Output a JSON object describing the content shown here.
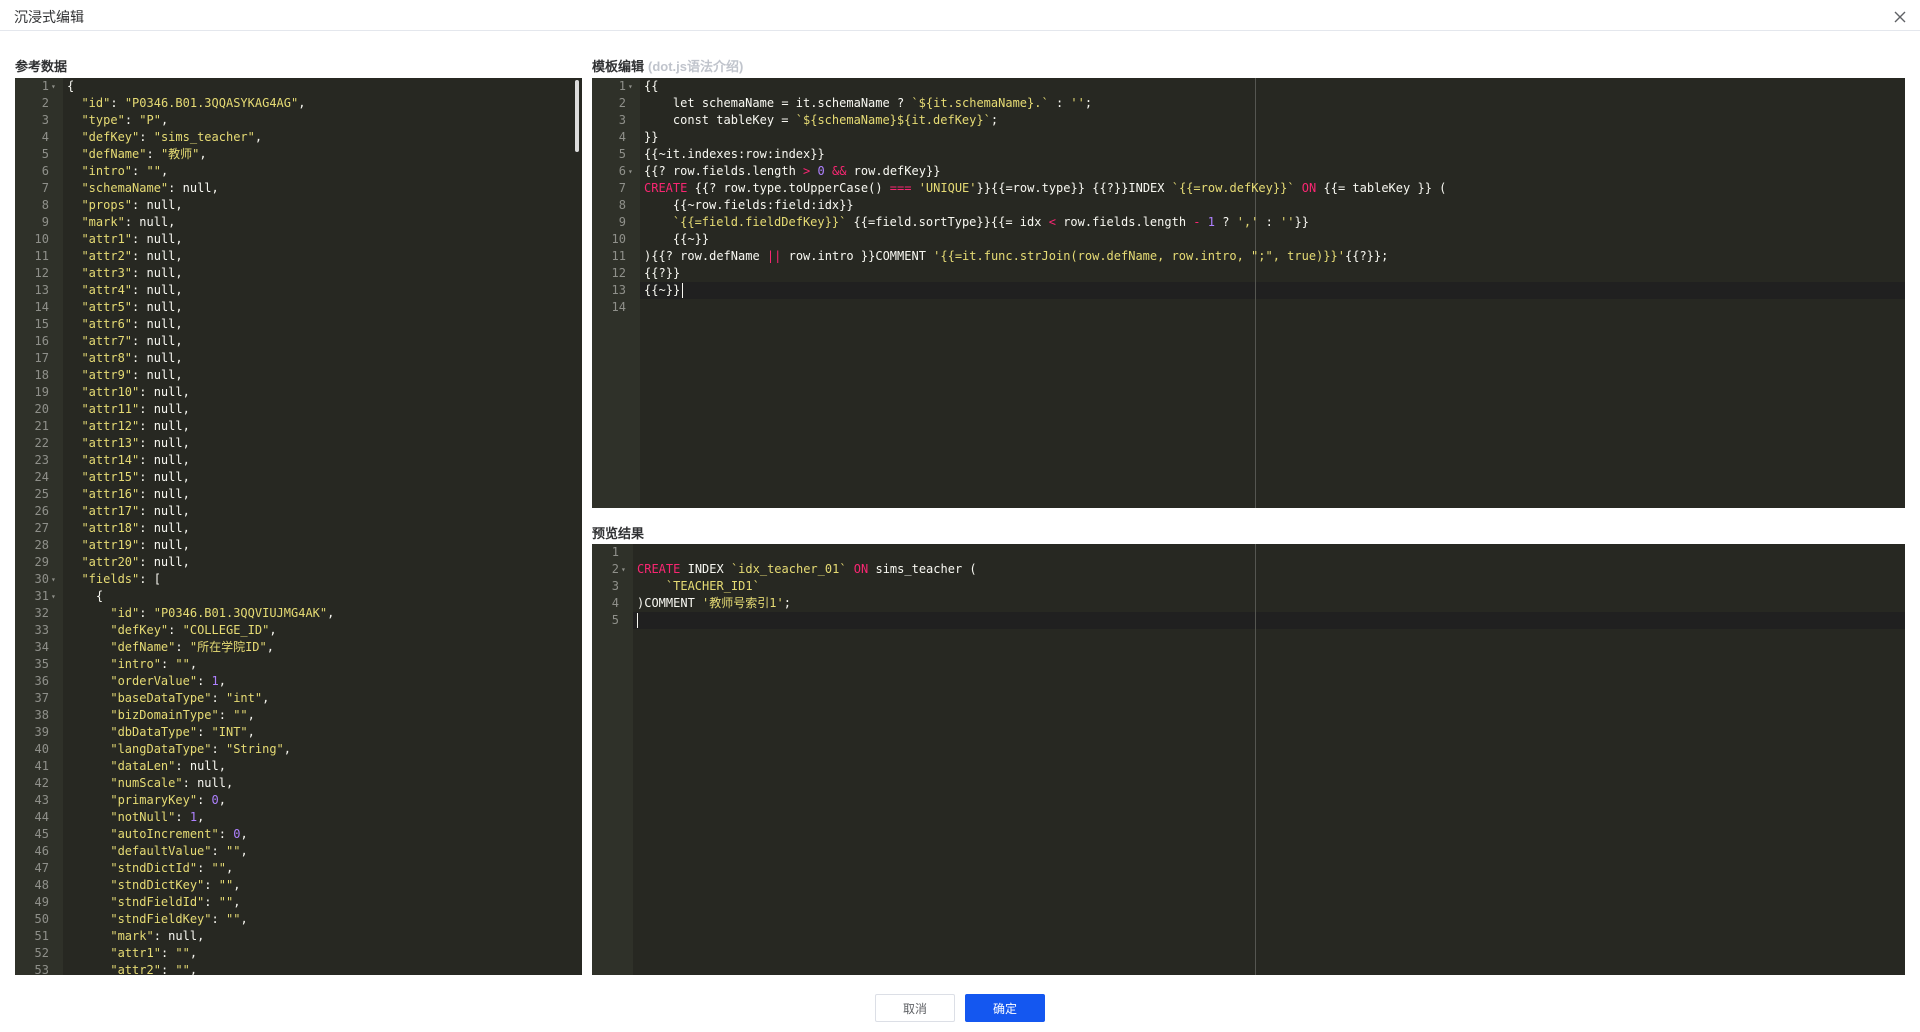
{
  "dialog": {
    "title": "沉浸式编辑"
  },
  "icons": {
    "close": "close-icon",
    "fold": "fold-arrow-icon"
  },
  "colors": {
    "editor_bg": "#272822",
    "primary_button": "#1457f0",
    "keyword": "#f92672",
    "string": "#e6db74",
    "number": "#ae81ff"
  },
  "reference": {
    "label": "参考数据",
    "lines": [
      "{",
      "  \"id\": \"P0346.B01.3QQASYKAG4AG\",",
      "  \"type\": \"P\",",
      "  \"defKey\": \"sims_teacher\",",
      "  \"defName\": \"教师\",",
      "  \"intro\": \"\",",
      "  \"schemaName\": null,",
      "  \"props\": null,",
      "  \"mark\": null,",
      "  \"attr1\": null,",
      "  \"attr2\": null,",
      "  \"attr3\": null,",
      "  \"attr4\": null,",
      "  \"attr5\": null,",
      "  \"attr6\": null,",
      "  \"attr7\": null,",
      "  \"attr8\": null,",
      "  \"attr9\": null,",
      "  \"attr10\": null,",
      "  \"attr11\": null,",
      "  \"attr12\": null,",
      "  \"attr13\": null,",
      "  \"attr14\": null,",
      "  \"attr15\": null,",
      "  \"attr16\": null,",
      "  \"attr17\": null,",
      "  \"attr18\": null,",
      "  \"attr19\": null,",
      "  \"attr20\": null,",
      "  \"fields\": [",
      "    {",
      "      \"id\": \"P0346.B01.3QQVIUJMG4AK\",",
      "      \"defKey\": \"COLLEGE_ID\",",
      "      \"defName\": \"所在学院ID\",",
      "      \"intro\": \"\",",
      "      \"orderValue\": 1,",
      "      \"baseDataType\": \"int\",",
      "      \"bizDomainType\": \"\",",
      "      \"dbDataType\": \"INT\",",
      "      \"langDataType\": \"String\",",
      "      \"dataLen\": null,",
      "      \"numScale\": null,",
      "      \"primaryKey\": 0,",
      "      \"notNull\": 1,",
      "      \"autoIncrement\": 0,",
      "      \"defaultValue\": \"\",",
      "      \"stndDictId\": \"\",",
      "      \"stndDictKey\": \"\",",
      "      \"stndFieldId\": \"\",",
      "      \"stndFieldKey\": \"\",",
      "      \"mark\": null,",
      "      \"attr1\": \"\",",
      "      \"attr2\": \"\","
    ],
    "fold_lines": [
      1,
      30,
      31
    ]
  },
  "template": {
    "label": "模板编辑",
    "hint": "(dot.js语法介绍)",
    "lines": [
      "{{",
      "    let schemaName = it.schemaName ? `${it.schemaName}.` : '';",
      "    const tableKey = `${schemaName}${it.defKey}`;",
      "}}",
      "{{~it.indexes:row:index}}",
      "{{? row.fields.length > 0 && row.defKey}}",
      "CREATE {{? row.type.toUpperCase() === 'UNIQUE'}}{{=row.type}} {{?}}INDEX `{{=row.defKey}}` ON {{= tableKey }} (",
      "    {{~row.fields:field:idx}}",
      "    `{{=field.fieldDefKey}}` {{=field.sortType}}{{= idx < row.fields.length - 1 ? ',' : ''}}",
      "    {{~}}",
      "){{? row.defName || row.intro }}COMMENT '{{=it.func.strJoin(row.defName, row.intro, \";\", true)}}'{{?}};",
      "{{?}}",
      "{{~}}",
      ""
    ],
    "fold_lines": [
      1,
      6
    ]
  },
  "preview": {
    "label": "预览结果",
    "lines": [
      "",
      "CREATE INDEX `idx_teacher_01` ON sims_teacher (",
      "    `TEACHER_ID1`",
      ")COMMENT '教师号索引1';",
      ""
    ],
    "fold_lines": [
      2
    ]
  },
  "footer": {
    "cancel_label": "取消",
    "confirm_label": "确定"
  }
}
